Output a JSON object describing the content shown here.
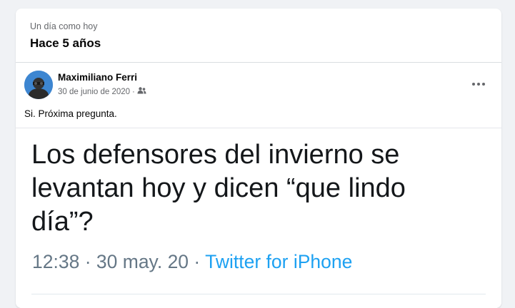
{
  "memory": {
    "subtitle": "Un día como hoy",
    "title": "Hace 5 años"
  },
  "post": {
    "author": "Maximiliano Ferri",
    "date": "30 de junio de 2020",
    "meta_separator": "·",
    "privacy_icon": "friends-icon",
    "menu_icon": "more-options-icon",
    "text": "Si. Próxima pregunta."
  },
  "tweet": {
    "text": "Los defensores del invierno se levantan hoy y dicen “que lindo día”?",
    "time": "12:38",
    "date": "30 may. 20",
    "separator": "·",
    "source": "Twitter for iPhone"
  },
  "colors": {
    "background": "#f0f2f5",
    "card": "#ffffff",
    "secondary_text": "#65676b",
    "twitter_blue": "#1da1f2"
  }
}
